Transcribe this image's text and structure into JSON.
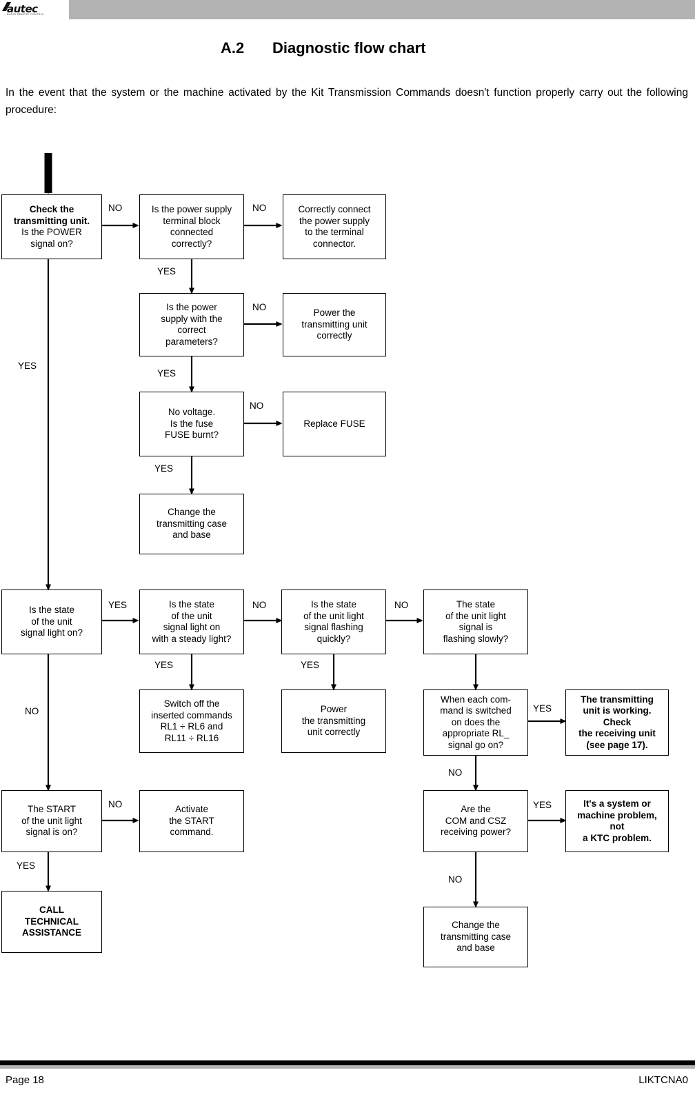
{
  "header": {
    "logo_word": "autec",
    "logo_sub": "RADIO REMOTE CONTROL"
  },
  "title": {
    "number": "A.2",
    "text": "Diagnostic flow chart"
  },
  "intro": "In the event that the system or the machine activated by the Kit Transmission Commands doesn't function properly carry out the following procedure:",
  "flow": {
    "nodes": [
      {
        "id": "n1",
        "text": "Check the\ntransmitting unit.\nIs the POWER\nsignal on?",
        "bold_lines": [
          0,
          1
        ]
      },
      {
        "id": "n2",
        "text": "Is the power supply\nterminal block\nconnected\ncorrectly?"
      },
      {
        "id": "n3",
        "text": "Correctly connect\nthe power supply\nto the terminal\nconnector."
      },
      {
        "id": "n4",
        "text": "Is the power\nsupply with the\ncorrect\nparameters?"
      },
      {
        "id": "n5",
        "text": "Power the\ntransmitting unit\ncorrectly"
      },
      {
        "id": "n6",
        "text": "No voltage.\nIs the fuse\nFUSE burnt?"
      },
      {
        "id": "n7",
        "text": "Replace FUSE"
      },
      {
        "id": "n8",
        "text": "Change the\ntransmitting case\nand base"
      },
      {
        "id": "n9",
        "text": "Is the state\nof the unit\nsignal light on?"
      },
      {
        "id": "n10",
        "text": "Is the state\nof the unit\nsignal light on\nwith a steady light?"
      },
      {
        "id": "n11",
        "text": "Is the state\nof the unit light\nsignal flashing\nquickly?"
      },
      {
        "id": "n12",
        "text": "The state\nof the unit light\nsignal is\nflashing slowly?"
      },
      {
        "id": "n13",
        "text": "Switch off the\ninserted commands\nRL1 ÷  RL6 and\nRL11 ÷ RL16"
      },
      {
        "id": "n14",
        "text": "Power\nthe transmitting\nunit correctly"
      },
      {
        "id": "n15",
        "text": "When each com-\nmand is switched\non does the\nappropriate RL_\nsignal go on?"
      },
      {
        "id": "n16",
        "text": "The transmitting\nunit is working.\nCheck\nthe receiving unit\n(see page 17).",
        "bold": true
      },
      {
        "id": "n17",
        "text": "The START\nof the unit light\nsignal is on?"
      },
      {
        "id": "n18",
        "text": "Activate\nthe START\ncommand."
      },
      {
        "id": "n19",
        "text": "Are the\nCOM and CSZ\nreceiving power?"
      },
      {
        "id": "n20",
        "text": "It's a system or\nmachine problem,\nnot\na KTC problem.",
        "bold": true
      },
      {
        "id": "n21",
        "text": "CALL\nTECHNICAL\nASSISTANCE",
        "bold": true
      },
      {
        "id": "n22",
        "text": "Change the\ntransmitting case\nand base"
      }
    ],
    "edge_labels": [
      {
        "id": "l1",
        "text": "NO"
      },
      {
        "id": "l2",
        "text": "NO"
      },
      {
        "id": "l3",
        "text": "YES"
      },
      {
        "id": "l4",
        "text": "NO"
      },
      {
        "id": "l5",
        "text": "YES"
      },
      {
        "id": "l6",
        "text": "NO"
      },
      {
        "id": "l7",
        "text": "YES"
      },
      {
        "id": "l8",
        "text": "YES"
      },
      {
        "id": "l9",
        "text": "YES"
      },
      {
        "id": "l10",
        "text": "NO"
      },
      {
        "id": "l11",
        "text": "NO"
      },
      {
        "id": "l12",
        "text": "YES"
      },
      {
        "id": "l13",
        "text": "YES"
      },
      {
        "id": "l14",
        "text": "NO"
      },
      {
        "id": "l15",
        "text": "YES"
      },
      {
        "id": "l16",
        "text": "NO"
      },
      {
        "id": "l17",
        "text": "NO"
      },
      {
        "id": "l18",
        "text": "YES"
      },
      {
        "id": "l19",
        "text": "YES"
      },
      {
        "id": "l20",
        "text": "NO"
      }
    ]
  },
  "footer": {
    "page": "Page 18",
    "code": "LIKTCNA0"
  }
}
